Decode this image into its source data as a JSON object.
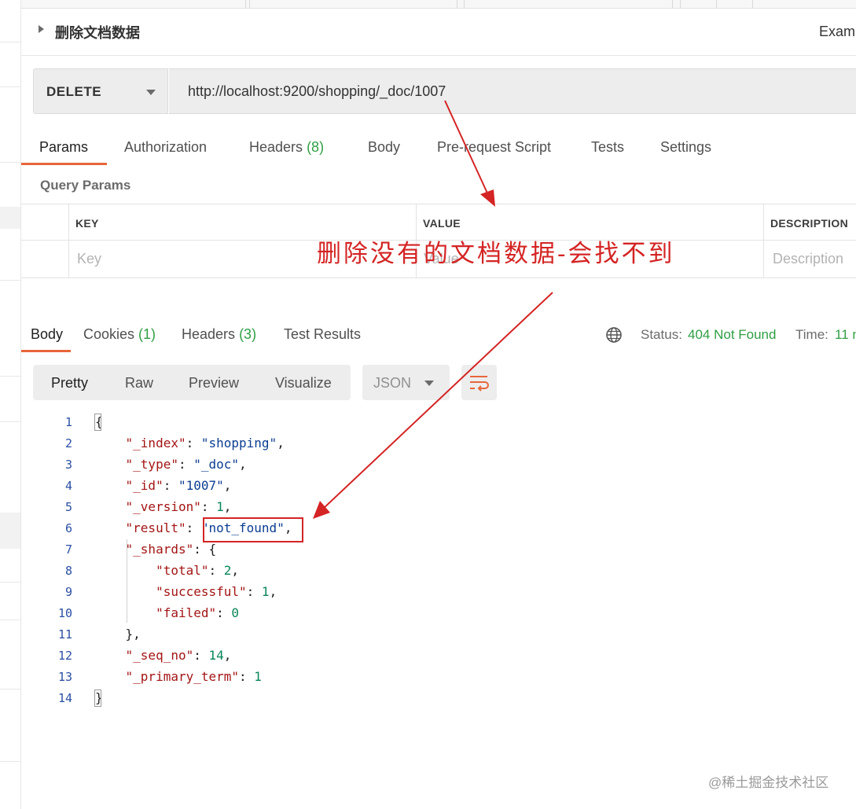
{
  "request": {
    "title": "删除文档数据",
    "examples_label": "Exam",
    "method": "DELETE",
    "url": "http://localhost:9200/shopping/_doc/1007"
  },
  "request_tabs": {
    "params": "Params",
    "authorization": "Authorization",
    "headers": "Headers",
    "headers_count": "(8)",
    "body": "Body",
    "pre_request_script": "Pre-request Script",
    "tests": "Tests",
    "settings": "Settings"
  },
  "query_params": {
    "title": "Query Params",
    "columns": {
      "key": "KEY",
      "value": "VALUE",
      "description": "DESCRIPTION"
    },
    "placeholders": {
      "key": "Key",
      "value": "Value",
      "description": "Description"
    }
  },
  "response_tabs": {
    "body": "Body",
    "cookies": "Cookies",
    "cookies_count": "(1)",
    "headers": "Headers",
    "headers_count": "(3)",
    "test_results": "Test Results"
  },
  "response_status": {
    "status_label": "Status:",
    "status_value": "404 Not Found",
    "time_label": "Time:",
    "time_value": "11 m"
  },
  "view_modes": {
    "pretty": "Pretty",
    "raw": "Raw",
    "preview": "Preview",
    "visualize": "Visualize",
    "format": "JSON"
  },
  "code_lines": [
    {
      "num": "1",
      "parts": [
        [
          "p",
          "{"
        ]
      ]
    },
    {
      "num": "2",
      "parts": [
        [
          "p",
          "    "
        ],
        [
          "k",
          "\"_index\""
        ],
        [
          "p",
          ": "
        ],
        [
          "s",
          "\"shopping\""
        ],
        [
          "p",
          ","
        ]
      ]
    },
    {
      "num": "3",
      "parts": [
        [
          "p",
          "    "
        ],
        [
          "k",
          "\"_type\""
        ],
        [
          "p",
          ": "
        ],
        [
          "s",
          "\"_doc\""
        ],
        [
          "p",
          ","
        ]
      ]
    },
    {
      "num": "4",
      "parts": [
        [
          "p",
          "    "
        ],
        [
          "k",
          "\"_id\""
        ],
        [
          "p",
          ": "
        ],
        [
          "s",
          "\"1007\""
        ],
        [
          "p",
          ","
        ]
      ]
    },
    {
      "num": "5",
      "parts": [
        [
          "p",
          "    "
        ],
        [
          "k",
          "\"_version\""
        ],
        [
          "p",
          ": "
        ],
        [
          "n",
          "1"
        ],
        [
          "p",
          ","
        ]
      ]
    },
    {
      "num": "6",
      "parts": [
        [
          "p",
          "    "
        ],
        [
          "k",
          "\"result\""
        ],
        [
          "p",
          ": "
        ],
        [
          "s",
          "\"not_found\""
        ],
        [
          "p",
          ","
        ]
      ]
    },
    {
      "num": "7",
      "parts": [
        [
          "p",
          "    "
        ],
        [
          "k",
          "\"_shards\""
        ],
        [
          "p",
          ": {"
        ]
      ]
    },
    {
      "num": "8",
      "parts": [
        [
          "p",
          "        "
        ],
        [
          "k",
          "\"total\""
        ],
        [
          "p",
          ": "
        ],
        [
          "n",
          "2"
        ],
        [
          "p",
          ","
        ]
      ]
    },
    {
      "num": "9",
      "parts": [
        [
          "p",
          "        "
        ],
        [
          "k",
          "\"successful\""
        ],
        [
          "p",
          ": "
        ],
        [
          "n",
          "1"
        ],
        [
          "p",
          ","
        ]
      ]
    },
    {
      "num": "10",
      "parts": [
        [
          "p",
          "        "
        ],
        [
          "k",
          "\"failed\""
        ],
        [
          "p",
          ": "
        ],
        [
          "n",
          "0"
        ]
      ]
    },
    {
      "num": "11",
      "parts": [
        [
          "p",
          "    },"
        ]
      ]
    },
    {
      "num": "12",
      "parts": [
        [
          "p",
          "    "
        ],
        [
          "k",
          "\"_seq_no\""
        ],
        [
          "p",
          ": "
        ],
        [
          "n",
          "14"
        ],
        [
          "p",
          ","
        ]
      ]
    },
    {
      "num": "13",
      "parts": [
        [
          "p",
          "    "
        ],
        [
          "k",
          "\"_primary_term\""
        ],
        [
          "p",
          ": "
        ],
        [
          "n",
          "1"
        ]
      ]
    },
    {
      "num": "14",
      "parts": [
        [
          "p",
          "}"
        ]
      ]
    }
  ],
  "annotation": {
    "text": "删除没有的文档数据-会找不到",
    "color": "#d42424"
  },
  "watermark": "@稀土掘金技术社区",
  "colors": {
    "accent": "#e8663b",
    "success": "#2f9e44",
    "json_key": "#a31515",
    "json_string": "#0b3d91",
    "json_number": "#098658"
  }
}
